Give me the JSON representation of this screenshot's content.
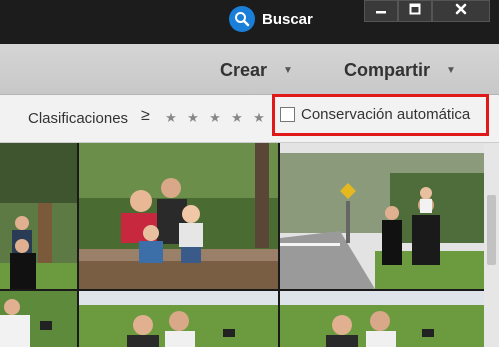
{
  "titlebar": {
    "search_label": "Buscar",
    "icons": {
      "search": "search-icon",
      "minimize": "minimize-icon",
      "maximize": "maximize-icon",
      "close": "close-icon"
    }
  },
  "toolbar": {
    "create_label": "Crear",
    "share_label": "Compartir"
  },
  "filter": {
    "ratings_label": "Clasificaciones",
    "ratings_operator": "≥",
    "stars": [
      "★",
      "★",
      "★",
      "★",
      "★"
    ],
    "autosave_label": "Conservación automática",
    "autosave_checked": false
  },
  "photos": [
    {
      "subject": "family-at-fence"
    },
    {
      "subject": "family-on-bench"
    },
    {
      "subject": "family-on-road"
    },
    {
      "subject": "family-on-lawn"
    },
    {
      "subject": "family-on-lawn"
    },
    {
      "subject": "family-on-lawn"
    }
  ],
  "colors": {
    "titlebar": "#1c1c1c",
    "search_accent": "#1a7fd9",
    "toolbar": "#d0d0d0",
    "filterbar": "#f2f2f2",
    "highlight": "#e01818"
  }
}
